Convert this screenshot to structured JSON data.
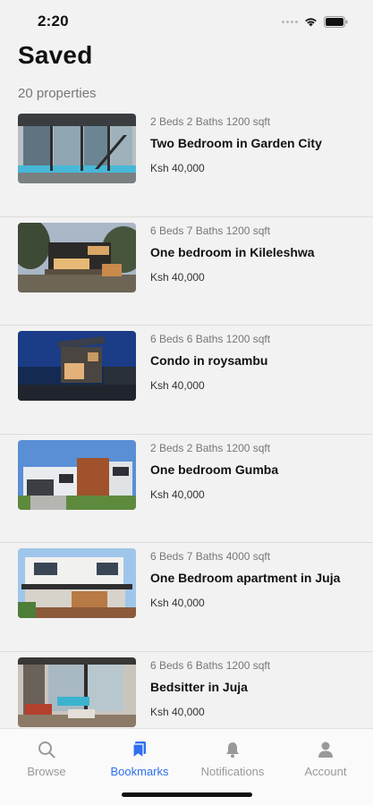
{
  "status_bar": {
    "time": "2:20"
  },
  "header": {
    "title": "Saved",
    "subtitle": "20 properties"
  },
  "properties": [
    {
      "meta": "2 Beds 2 Baths 1200 sqft",
      "title": "Two Bedroom in Garden City",
      "price": "Ksh 40,000"
    },
    {
      "meta": "6 Beds 7 Baths 1200 sqft",
      "title": "One bedroom in Kileleshwa",
      "price": "Ksh 40,000"
    },
    {
      "meta": "6 Beds 6 Baths 1200 sqft",
      "title": "Condo in roysambu",
      "price": "Ksh 40,000"
    },
    {
      "meta": "2 Beds 2 Baths 1200 sqft",
      "title": "One bedroom Gumba",
      "price": "Ksh 40,000"
    },
    {
      "meta": "6 Beds 7 Baths 4000 sqft",
      "title": "One Bedroom apartment in Juja",
      "price": "Ksh 40,000"
    },
    {
      "meta": "6 Beds 6 Baths 1200 sqft",
      "title": "Bedsitter in Juja",
      "price": "Ksh 40,000"
    }
  ],
  "tabs": [
    {
      "label": "Browse",
      "icon": "search-icon",
      "active": false
    },
    {
      "label": "Bookmarks",
      "icon": "bookmark-icon",
      "active": true
    },
    {
      "label": "Notifications",
      "icon": "bell-icon",
      "active": false
    },
    {
      "label": "Account",
      "icon": "person-icon",
      "active": false
    }
  ],
  "colors": {
    "accent": "#2f6ff0",
    "background": "#f2f2f2",
    "inactive_tab": "#999999"
  }
}
